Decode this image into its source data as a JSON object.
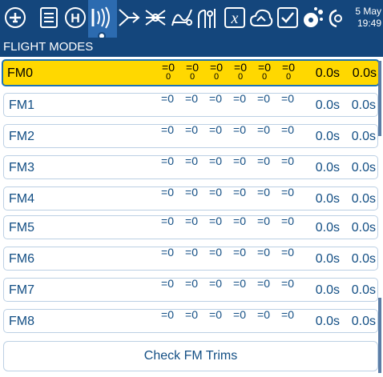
{
  "topbar": {
    "icons": [
      "airplane-icon",
      "list-icon",
      "helicopter-icon",
      "radio-icon",
      "mixer-icon",
      "outputs-icon",
      "curves-icon",
      "logic-switch-icon",
      "special-function-icon",
      "telemetry-icon",
      "checklist-icon",
      "settings-icon",
      "globe-icon"
    ],
    "date_day": "5 May",
    "date_time": "19:49"
  },
  "section": {
    "title": "FLIGHT MODES"
  },
  "modes": [
    {
      "label": "FM0",
      "trims": [
        "=0",
        "=0",
        "=0",
        "=0",
        "=0",
        "=0"
      ],
      "subs": [
        "0",
        "0",
        "0",
        "0",
        "0",
        "0"
      ],
      "fade_in": "0.0s",
      "fade_out": "0.0s",
      "selected": true
    },
    {
      "label": "FM1",
      "trims": [
        "=0",
        "=0",
        "=0",
        "=0",
        "=0",
        "=0"
      ],
      "fade_in": "0.0s",
      "fade_out": "0.0s"
    },
    {
      "label": "FM2",
      "trims": [
        "=0",
        "=0",
        "=0",
        "=0",
        "=0",
        "=0"
      ],
      "fade_in": "0.0s",
      "fade_out": "0.0s"
    },
    {
      "label": "FM3",
      "trims": [
        "=0",
        "=0",
        "=0",
        "=0",
        "=0",
        "=0"
      ],
      "fade_in": "0.0s",
      "fade_out": "0.0s"
    },
    {
      "label": "FM4",
      "trims": [
        "=0",
        "=0",
        "=0",
        "=0",
        "=0",
        "=0"
      ],
      "fade_in": "0.0s",
      "fade_out": "0.0s"
    },
    {
      "label": "FM5",
      "trims": [
        "=0",
        "=0",
        "=0",
        "=0",
        "=0",
        "=0"
      ],
      "fade_in": "0.0s",
      "fade_out": "0.0s"
    },
    {
      "label": "FM6",
      "trims": [
        "=0",
        "=0",
        "=0",
        "=0",
        "=0",
        "=0"
      ],
      "fade_in": "0.0s",
      "fade_out": "0.0s"
    },
    {
      "label": "FM7",
      "trims": [
        "=0",
        "=0",
        "=0",
        "=0",
        "=0",
        "=0"
      ],
      "fade_in": "0.0s",
      "fade_out": "0.0s"
    },
    {
      "label": "FM8",
      "trims": [
        "=0",
        "=0",
        "=0",
        "=0",
        "=0",
        "=0"
      ],
      "fade_in": "0.0s",
      "fade_out": "0.0s"
    }
  ],
  "bottom": {
    "check_trims": "Check FM Trims"
  }
}
